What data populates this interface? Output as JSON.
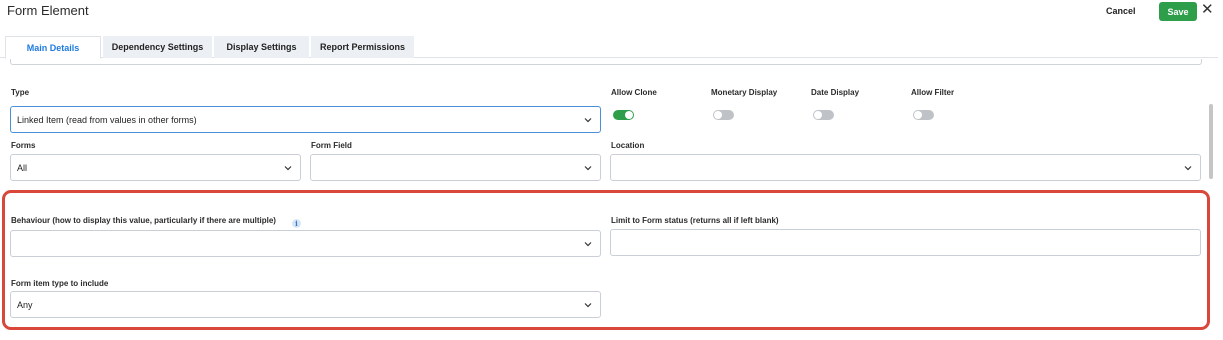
{
  "header": {
    "title": "Form Element",
    "cancel_label": "Cancel",
    "save_label": "Save",
    "close_glyph": "✕"
  },
  "tabs": [
    {
      "label": "Main Details",
      "active": true
    },
    {
      "label": "Dependency Settings",
      "active": false
    },
    {
      "label": "Display Settings",
      "active": false
    },
    {
      "label": "Report Permissions",
      "active": false
    }
  ],
  "form": {
    "type": {
      "label": "Type",
      "value": "Linked Item (read from values in other forms)"
    },
    "toggles": [
      {
        "label": "Allow Clone",
        "on": true
      },
      {
        "label": "Monetary Display",
        "on": false
      },
      {
        "label": "Date Display",
        "on": false
      },
      {
        "label": "Allow Filter",
        "on": false
      }
    ],
    "forms": {
      "label": "Forms",
      "value": "All"
    },
    "form_field": {
      "label": "Form Field",
      "value": ""
    },
    "location": {
      "label": "Location",
      "value": ""
    },
    "behaviour": {
      "label": "Behaviour (how to display this value, particularly if there are multiple)",
      "value": "",
      "info_glyph": "i"
    },
    "limit_status": {
      "label": "Limit to Form status (returns all if left blank)",
      "value": ""
    },
    "item_type": {
      "label": "Form item type to include",
      "value": "Any"
    }
  },
  "colors": {
    "accent_green": "#2e9e4a",
    "tab_active_blue": "#1f7ae0",
    "highlight_red": "#d9473a"
  }
}
